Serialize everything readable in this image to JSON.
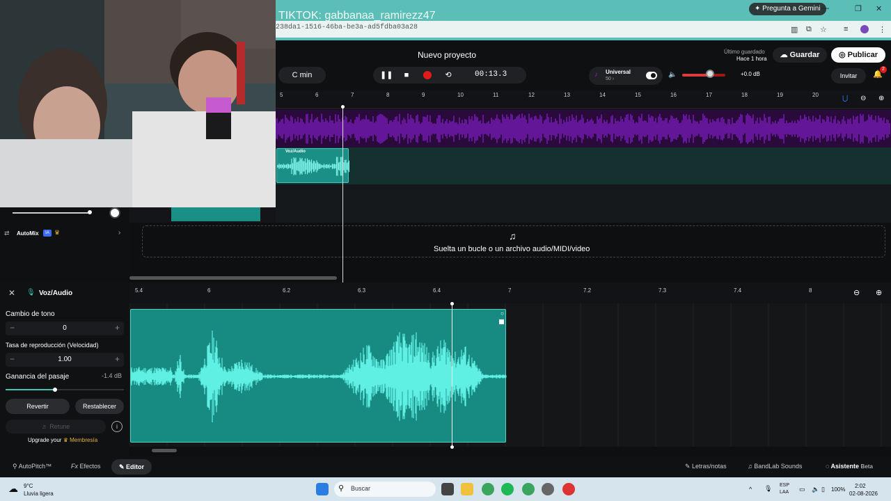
{
  "browser": {
    "gemini_label": "Pregunta a Gemini",
    "url_fragment": "238da1-1516-46ba-be3a-ad5fdba03a28",
    "overlay_text": "TIKTOK: gabbanaa_ramirezz47"
  },
  "header": {
    "project_title": "Nuevo proyecto",
    "key": "C min",
    "time": "00:13.3",
    "tuner_title": "Universal",
    "tuner_value": "50 ›",
    "master_gain": "+0.0 dB",
    "master_volume_fraction": 0.65,
    "saved_label": "Último guardado",
    "saved_time": "Hace 1 hora",
    "save": "Guardar",
    "publish": "Publicar",
    "invite": "Invitar",
    "notifications": "2"
  },
  "timeline": {
    "ticks": [
      "5",
      "6",
      "7",
      "8",
      "9",
      "10",
      "11",
      "12",
      "13",
      "14",
      "15",
      "16",
      "17",
      "18",
      "19",
      "20"
    ],
    "clip_label": "Voz/Audio",
    "drop_text": "Suelta un bucle o un archivo audio/MIDI/video"
  },
  "left_panel": {
    "automix": "AutoMix",
    "ia": "IA"
  },
  "editor": {
    "title": "Voz/Audio",
    "pitch_label": "Cambio de tono",
    "pitch_value": "0",
    "rate_label": "Tasa de reproducción (Velocidad)",
    "rate_value": "1.00",
    "gain_label": "Ganancia del pasaje",
    "gain_value": "-1.4 dB",
    "gain_fraction": 0.42,
    "revert": "Revertir",
    "reset": "Restablecer",
    "retune": "Retune",
    "upgrade_prefix": "Upgrade your",
    "membership": "Membresía",
    "ticks": [
      "5.4",
      "6",
      "6.2",
      "6.3",
      "6.4",
      "7",
      "7.2",
      "7.3",
      "7.4",
      "8"
    ]
  },
  "bottom": {
    "autopitch": "AutoPitch™",
    "effects": "Efectos",
    "editor": "Editor",
    "lyrics": "Letras/notas",
    "sounds": "BandLab Sounds",
    "assistant": "Asistente",
    "beta": "Beta"
  },
  "taskbar": {
    "temp": "9°C",
    "weather": "Lluvia ligera",
    "search": "Buscar",
    "lang1": "ESP",
    "lang2": "LAA",
    "battery": "100%",
    "time": "2:02",
    "date": "02-08-2026"
  },
  "colors": {
    "accent_teal": "#40c6bb",
    "purple_wave": "#8a1fd6",
    "record_red": "#e21b1b"
  }
}
